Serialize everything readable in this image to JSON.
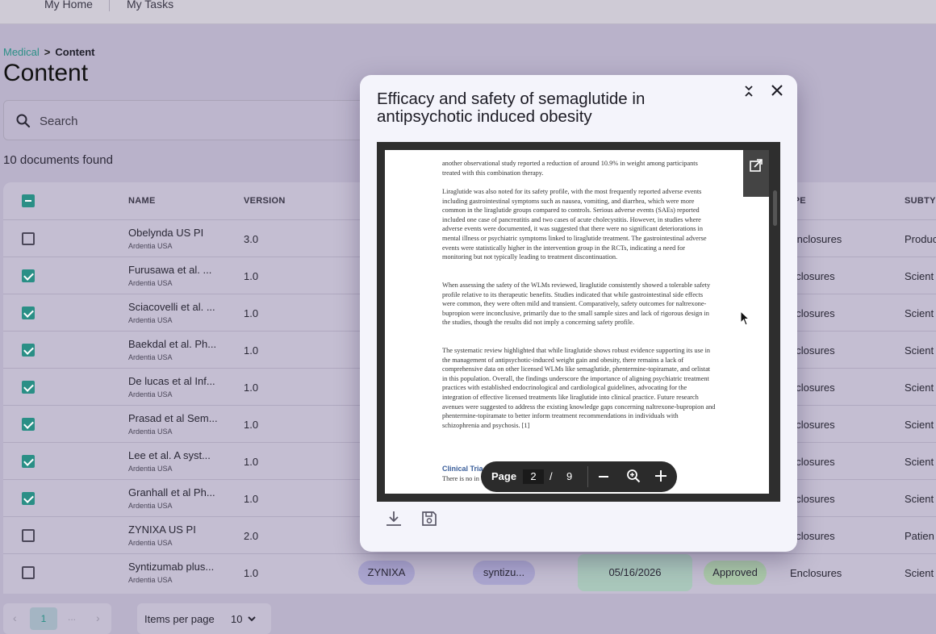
{
  "topnav": {
    "home": "My Home",
    "tasks": "My Tasks"
  },
  "breadcrumb": {
    "parent": "Medical",
    "current": "Content"
  },
  "page_title": "Content",
  "search": {
    "placeholder": "Search"
  },
  "result_count": "10 documents found",
  "table": {
    "headers": {
      "name": "NAME",
      "version": "VERSION",
      "type": "TYPE",
      "subtype": "SUBTYPE"
    },
    "rows": [
      {
        "name": "Obelynda US PI",
        "org": "Ardentia USA",
        "version": "3.0",
        "type": "Enclosures",
        "subtype": "Produc",
        "checked": false
      },
      {
        "name": "Furusawa et al. ...",
        "org": "Ardentia USA",
        "version": "1.0",
        "type": "nclosures",
        "subtype": "Scient",
        "checked": true
      },
      {
        "name": "Sciacovelli et al. ...",
        "org": "Ardentia USA",
        "version": "1.0",
        "type": "nclosures",
        "subtype": "Scient",
        "checked": true
      },
      {
        "name": "Baekdal et al. Ph...",
        "org": "Ardentia USA",
        "version": "1.0",
        "type": "nclosures",
        "subtype": "Scient",
        "checked": true
      },
      {
        "name": "De lucas et al Inf...",
        "org": "Ardentia USA",
        "version": "1.0",
        "type": "nclosures",
        "subtype": "Scient",
        "checked": true
      },
      {
        "name": "Prasad et al Sem...",
        "org": "Ardentia USA",
        "version": "1.0",
        "type": "nclosures",
        "subtype": "Scient",
        "checked": true
      },
      {
        "name": "Lee et al. A syst...",
        "org": "Ardentia USA",
        "version": "1.0",
        "type": "nclosures",
        "subtype": "Scient",
        "checked": true
      },
      {
        "name": "Granhall et al Ph...",
        "org": "Ardentia USA",
        "version": "1.0",
        "type": "nclosures",
        "subtype": "Scient",
        "checked": true
      },
      {
        "name": "ZYNIXA US PI",
        "org": "Ardentia USA",
        "version": "2.0",
        "type": "nclosures",
        "subtype": "Patien",
        "checked": false
      },
      {
        "name": "Syntizumab plus...",
        "org": "Ardentia USA",
        "version": "1.0",
        "type": "Enclosures",
        "subtype": "Scient",
        "checked": false,
        "product": "ZYNIXA",
        "molecule": "syntizu...",
        "date": "05/16/2026",
        "status": "Approved"
      }
    ]
  },
  "pagination": {
    "current_page": "1",
    "prev": "‹",
    "next": "›",
    "dots": "...",
    "items_per_page_label": "Items per page",
    "items_per_page": "10"
  },
  "modal": {
    "title": "Efficacy and safety of semaglutide in antipsychotic induced obesity",
    "document": {
      "paragraphs": [
        "another observational study reported a reduction of around 10.9% in weight among participants treated with this combination therapy.",
        "Liraglutide was also noted for its safety profile, with the most frequently reported adverse events including gastrointestinal symptoms such as nausea, vomiting, and diarrhea, which were more common in the liraglutide groups compared to controls. Serious adverse events (SAEs) reported included one case of pancreatitis and two cases of acute cholecystitis. However, in studies where adverse events were documented, it was suggested that there were no significant deteriorations in mental illness or psychiatric symptoms linked to liraglutide treatment. The gastrointestinal adverse events were statistically higher in the intervention group in the RCTs, indicating a need for monitoring but not typically leading to treatment discontinuation.",
        "When assessing the safety of the WLMs reviewed, liraglutide consistently showed a tolerable safety profile relative to its therapeutic benefits. Studies indicated that while gastrointestinal side effects were common, they were often mild and transient. Comparatively, safety outcomes for naltrexone-bupropion were inconclusive, primarily due to the small sample sizes and lack of rigorous design in the studies, though the results did not imply a concerning safety profile.",
        "The systematic review highlighted that while liraglutide shows robust evidence supporting its use in the management of antipsychotic-induced weight gain and obesity, there remains a lack of comprehensive data on other licensed WLMs like semaglutide, phentermine-topiramate, and orlistat in this population. Overall, the findings underscore the importance of aligning psychiatric treatment practices with established endocrinological and cardiological guidelines, advocating for the integration of effective licensed treatments like liraglutide into clinical practice. Future research avenues were suggested to address the existing knowledge gaps concerning naltrexone-bupropion and phentermine-topiramate to better inform treatment recommendations in individuals with schizophrenia and psychosis. [1]"
      ],
      "section_title": "Clinical Tria",
      "section_text": "There is no in"
    },
    "viewer_toolbar": {
      "page_label": "Page",
      "current_page": "2",
      "separator": "/",
      "total_pages": "9"
    }
  },
  "icons": {
    "search": "search-icon",
    "collapse": "collapse-icon",
    "close": "close-icon",
    "external": "open-external-icon",
    "zoom_out": "minus-icon",
    "zoom_fit": "zoom-icon",
    "zoom_in": "plus-icon",
    "download": "download-icon",
    "save": "save-icon"
  },
  "colors": {
    "accent": "#2a8f86",
    "modal_bg": "#f4f4fb",
    "viewer_bg": "#2e2e2e"
  }
}
